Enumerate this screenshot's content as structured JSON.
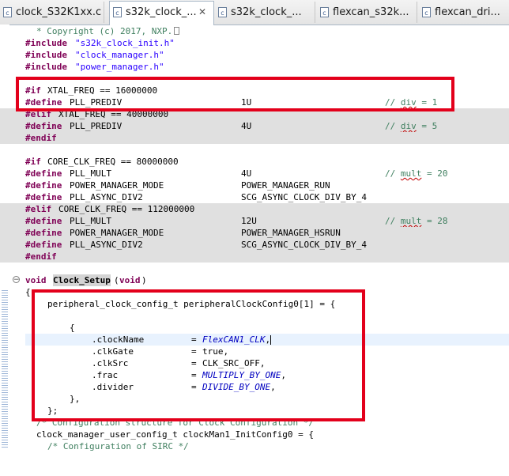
{
  "tabs": [
    {
      "label": "clock_S32K1xx.c",
      "active": false
    },
    {
      "label": "s32k_clock_...",
      "active": true,
      "close": "✕"
    },
    {
      "label": "s32k_clock_...",
      "active": false
    },
    {
      "label": "flexcan_s32k...",
      "active": false
    },
    {
      "label": "flexcan_dri...",
      "active": false
    }
  ],
  "file_icon_glyph": "c",
  "code": {
    "copyright": "* Copyright (c) 2017, NXP.",
    "inc_kw": "#include",
    "inc1": "\"s32k_clock_init.h\"",
    "inc2": "\"clock_manager.h\"",
    "inc3": "\"power_manager.h\"",
    "if_kw": "#if",
    "elif_kw": "#elif",
    "define_kw": "#define",
    "endif_kw": "#endif",
    "xtal1": "XTAL_FREQ == 16000000",
    "xtal2": "XTAL_FREQ == 40000000",
    "pll_prediv": "PLL_PREDIV",
    "v1u": "1U",
    "v4u": "4U",
    "cmt_slash": "// ",
    "div_word": "div",
    "div1_rest": " = 1",
    "div5_rest": " = 5",
    "core1": "CORE_CLK_FREQ == 80000000",
    "core2": "CORE_CLK_FREQ == 112000000",
    "pll_mult": "PLL_MULT",
    "power_mode": "POWER_MANAGER_MODE",
    "pll_async": "PLL_ASYNC_DIV2",
    "v12u": "12U",
    "pm_run": "POWER_MANAGER_RUN",
    "pm_hsrun": "POWER_MANAGER_HSRUN",
    "async_div4": "SCG_ASYNC_CLOCK_DIV_BY_4",
    "mult_word": "mult",
    "mult20_rest": " = 20",
    "mult28_rest": " = 28",
    "void_kw": "void",
    "clock_setup": "Clock_Setup",
    "lparen": "(",
    "rparen": ")",
    "open_brace": "{",
    "periph_decl": "peripheral_clock_config_t peripheralClockConfig0[1] = {",
    "inner_open": "{",
    "f_name": ".clockName",
    "f_gate": ".clkGate",
    "f_src": ".clkSrc",
    "f_frac": ".frac",
    "f_div": ".divider",
    "eq": "= ",
    "v_name": "FlexCAN1_CLK",
    "v_gate": "true,",
    "v_src": "CLK_SRC_OFF,",
    "v_frac": "MULTIPLY_BY_ONE",
    "v_div": "DIVIDE_BY_ONE",
    "comma": ",",
    "inner_close": "},",
    "outer_close": "};",
    "cmt_cfg": "/* Configuration structure for Clock Configuration */",
    "man_decl": "clock_manager_user_config_t clockMan1_InitConfig0 = {",
    "cmt_sirc": "/* Configuration of SIRC */"
  },
  "fold_glyph": "−",
  "colors": {
    "highlight_box": "#e3001b",
    "preprocessor_gray": "#e0e0e0",
    "current_line": "#e8f2fe"
  }
}
